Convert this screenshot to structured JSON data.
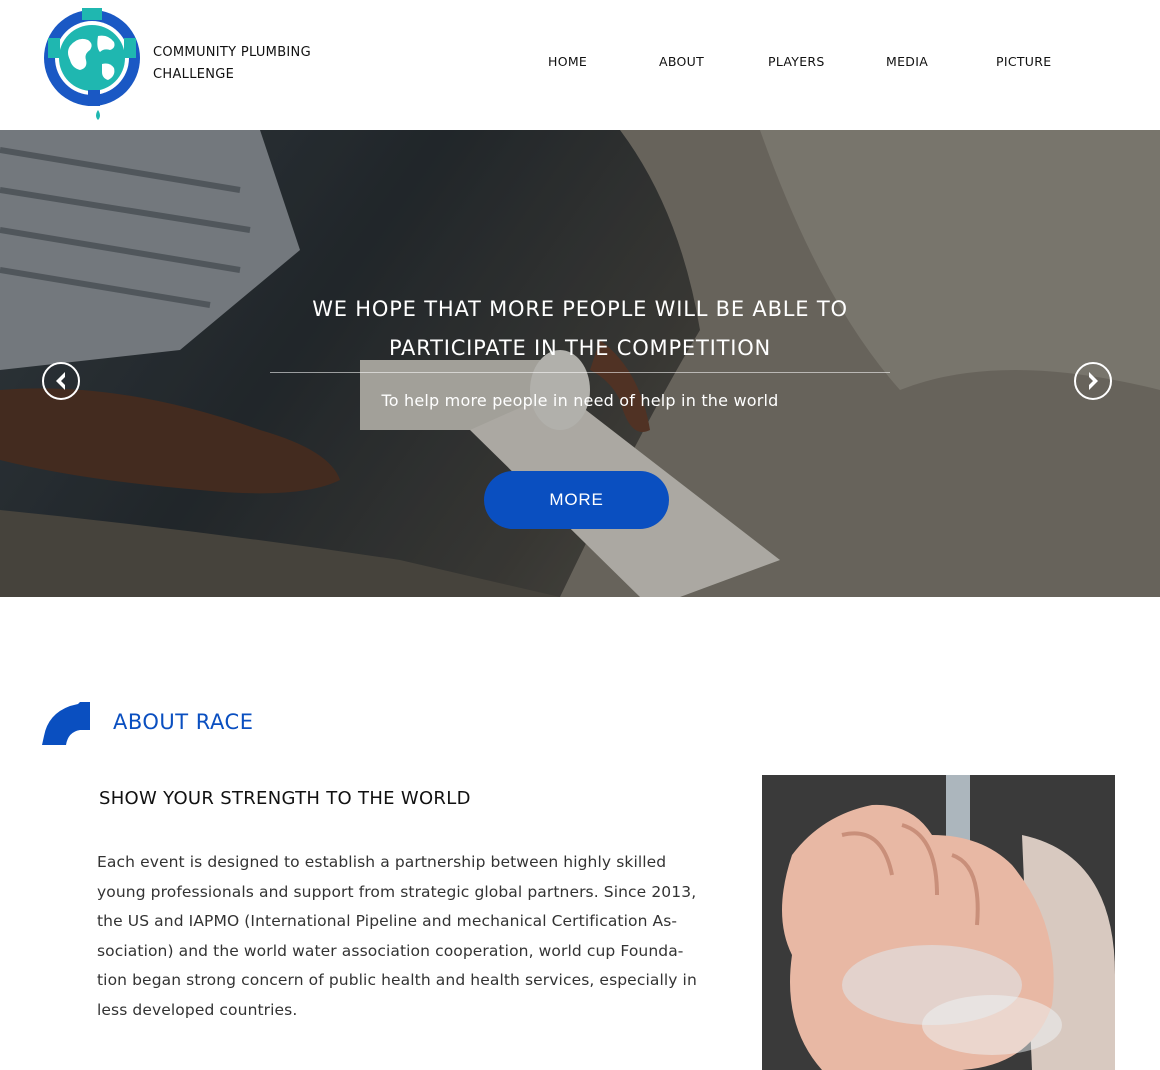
{
  "brand": {
    "line1": "COMMUNITY PLUMBING",
    "line2": "CHALLENGE",
    "logo_icon": "globe-faucet-logo-icon"
  },
  "nav": {
    "items": [
      "HOME",
      "ABOUT",
      "PLAYERS",
      "MEDIA",
      "PICTURE"
    ]
  },
  "hero": {
    "title_line1": "WE HOPE THAT MORE PEOPLE WILL BE ABLE TO",
    "title_line2": "PARTICIPATE IN THE COMPETITION",
    "subtitle": "To help more people in need of help in the world",
    "button_label": "MORE",
    "prev_icon": "chevron-left-icon",
    "next_icon": "chevron-right-icon"
  },
  "about": {
    "heading": "ABOUT RACE",
    "heading_icon": "pipe-elbow-icon",
    "subheading": "SHOW YOUR STRENGTH TO THE WORLD",
    "body": "Each event is designed to establish a partnership between highly skilled young professionals and support from strategic global partners. Since 2013, the US and IAPMO (International Pipeline and mechanical Certification As-sociation) and the world water association cooperation, world cup Founda-tion began strong concern of public health and health services, especially in less developed countries."
  },
  "colors": {
    "accent_blue": "#0a4fc0",
    "logo_teal": "#1fb7b0"
  }
}
